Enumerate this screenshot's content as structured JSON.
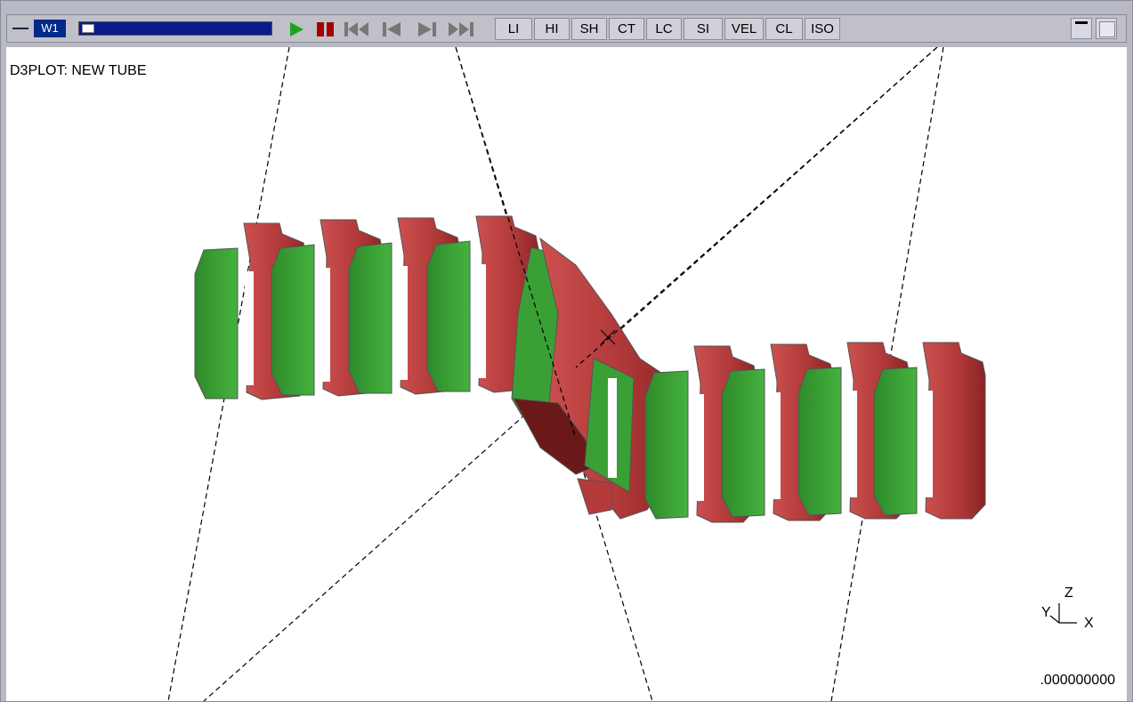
{
  "window": {
    "title": "W1"
  },
  "toolbar": {
    "play_icon": "play-icon",
    "pause_icon": "pause-icon",
    "buttons": [
      "LI",
      "HI",
      "SH",
      "CT",
      "LC",
      "SI",
      "VEL",
      "CL",
      "ISO"
    ]
  },
  "viewport": {
    "plot_title": "D3PLOT: NEW TUBE",
    "timestamp": ".000000000",
    "triad": {
      "z": "Z",
      "y": "Y",
      "x": "X"
    }
  },
  "colors": {
    "red_part": "#b53a3a",
    "green_part": "#3a9a35",
    "title_bg": "#002a8a"
  }
}
